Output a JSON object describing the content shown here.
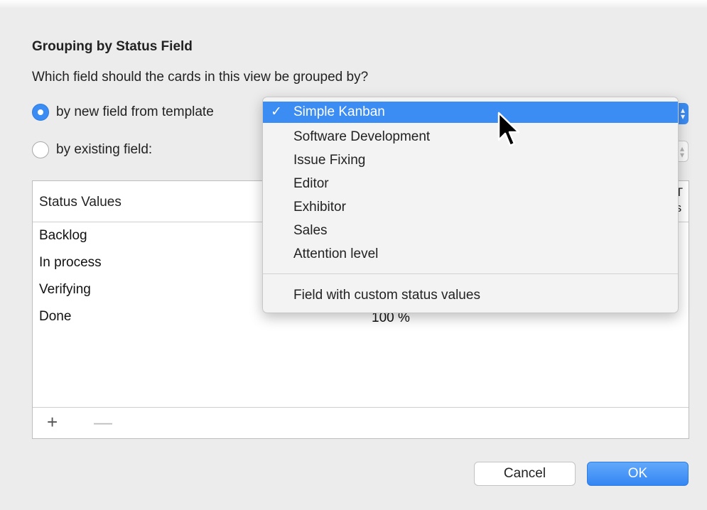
{
  "dialog": {
    "title": "Grouping by Status Field",
    "question": "Which field should the cards in this view be grouped by?",
    "option_template_label": "by new field from template",
    "option_existing_label": "by existing field:"
  },
  "dropdown": {
    "selected": "Simple Kanban",
    "check_mark": "✓",
    "items": [
      "Simple Kanban",
      "Software Development",
      "Issue Fixing",
      "Editor",
      "Exhibitor",
      "Sales",
      "Attention level"
    ],
    "custom_item": "Field with custom status values"
  },
  "table": {
    "column_header": "Status Values",
    "column_header2_partial": "T\ns",
    "rows": [
      "Backlog",
      "In process",
      "Verifying",
      "Done"
    ],
    "done_value_partial": "100 %"
  },
  "footer": {
    "add_symbol": "+",
    "remove_symbol": "—"
  },
  "buttons": {
    "cancel": "Cancel",
    "ok": "OK"
  },
  "colors": {
    "accent": "#3b8cf3"
  }
}
